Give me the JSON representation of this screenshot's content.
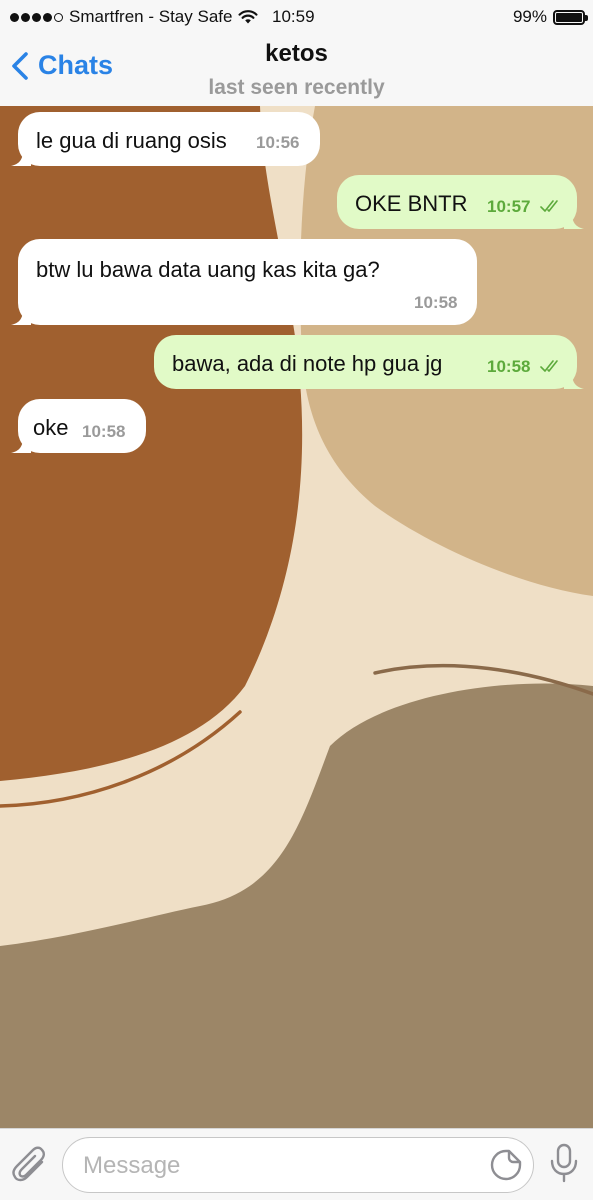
{
  "status_bar": {
    "carrier": "Smartfren - Stay Safe",
    "time": "10:59",
    "battery_percent": "99%",
    "battery_level": 0.99,
    "signal_bars": 4
  },
  "nav": {
    "back_label": "Chats",
    "title": "ketos",
    "subtitle": "last seen recently"
  },
  "messages": [
    {
      "direction": "in",
      "text": "le gua di ruang osis",
      "time": "10:56"
    },
    {
      "direction": "out",
      "text": "OKE BNTR",
      "time": "10:57",
      "status": "read"
    },
    {
      "direction": "in",
      "text": "btw lu bawa data uang kas kita ga?",
      "time": "10:58"
    },
    {
      "direction": "out",
      "text": "bawa, ada di note hp gua jg",
      "time": "10:58",
      "status": "read"
    },
    {
      "direction": "in",
      "text": "oke",
      "time": "10:58"
    }
  ],
  "input": {
    "placeholder": "Message"
  },
  "colors": {
    "accent": "#2a83e6",
    "outgoing_bubble": "#e1fac7",
    "outgoing_time": "#5daa3c",
    "wallpaper_base": "#efdfc6",
    "wallpaper_brown": "#a0602f",
    "wallpaper_tan": "#d2b489",
    "wallpaper_taupe": "#9c8667"
  },
  "icons": {
    "back": "chevron-left-icon",
    "attach": "paperclip-icon",
    "sticker": "sticker-icon",
    "mic": "microphone-icon",
    "wifi": "wifi-icon",
    "battery": "battery-icon"
  }
}
